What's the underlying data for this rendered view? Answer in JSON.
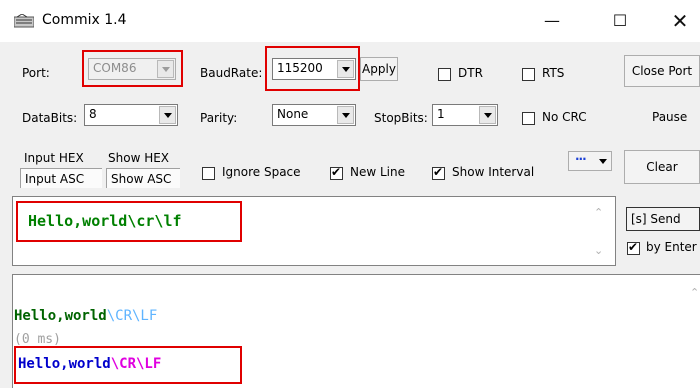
{
  "window": {
    "title": "Commix 1.4",
    "minimize_glyph": "—",
    "maximize_glyph": "☐",
    "close_glyph": "✕"
  },
  "row1": {
    "port_label": "Port:",
    "port_value": "COM86",
    "baud_label": "BaudRate:",
    "baud_value": "115200",
    "apply_label": "Apply",
    "dtr_label": "DTR",
    "rts_label": "RTS",
    "close_port_label": "Close Port"
  },
  "row2": {
    "databits_label": "DataBits:",
    "databits_value": "8",
    "parity_label": "Parity:",
    "parity_value": "None",
    "stopbits_label": "StopBits:",
    "stopbits_value": "1",
    "nocrc_label": "No CRC",
    "pause_label": "Pause"
  },
  "row3": {
    "input_hex_label": "Input HEX",
    "show_hex_label": "Show HEX",
    "input_asc_label": "Input ASC",
    "show_asc_label": "Show ASC",
    "ignore_space_label": "Ignore Space",
    "new_line_label": "New Line",
    "show_interval_label": "Show Interval",
    "more_label": "···",
    "clear_label": "Clear"
  },
  "send": {
    "input_value_text": "Hello,world",
    "input_value_esc": "\\cr\\lf",
    "send_label": "[s] Send",
    "by_enter_label": "by Enter"
  },
  "output": {
    "line1_text": "Hello,world",
    "line1_esc": "\\CR\\LF",
    "line2_text": "(0 ms)",
    "line3_text": "Hello,world",
    "line3_esc": "\\CR\\LF"
  },
  "colors": {
    "send_text": "#008000",
    "line1_text": "#006400",
    "line1_esc": "#5fb4ff",
    "interval": "#a0a0a0",
    "line3_text": "#0000cc",
    "line3_esc": "#e000e0",
    "highlight": "#e00000"
  }
}
